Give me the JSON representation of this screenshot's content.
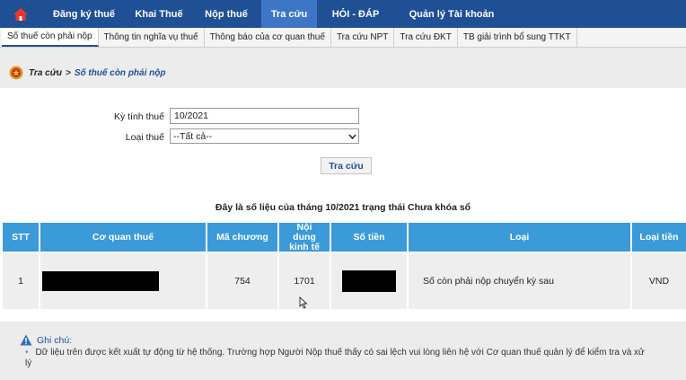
{
  "topnav": {
    "items": [
      {
        "label": "Đăng ký thuế"
      },
      {
        "label": "Khai Thuế"
      },
      {
        "label": "Nộp thuế"
      },
      {
        "label": "Tra cứu"
      },
      {
        "label": "HỎI - ĐÁP"
      },
      {
        "label": "Quản lý Tài khoản"
      }
    ],
    "active_index": 3,
    "color": "#1f4f94",
    "active_color": "#3d76c4"
  },
  "subnav": {
    "tabs": [
      {
        "label": "Số thuế còn phải nộp"
      },
      {
        "label": "Thông tin nghĩa vụ thuế"
      },
      {
        "label": "Thông báo của cơ quan thuế"
      },
      {
        "label": "Tra cứu NPT"
      },
      {
        "label": "Tra cứu ĐKT"
      },
      {
        "label": "TB giải trình bổ sung TTKT"
      }
    ],
    "active_index": 0
  },
  "breadcrumb": {
    "parent": "Tra cứu",
    "separator": ">",
    "current": "Số thuế còn phải nộp"
  },
  "form": {
    "period_label": "Kỳ tính thuế",
    "period_value": "10/2021",
    "type_label": "Loại thuế",
    "type_selected": "--Tất cả--",
    "search_button": "Tra cứu"
  },
  "caption": "Đây là số liệu của tháng 10/2021 trạng thái Chưa khóa sổ",
  "table": {
    "header_color": "#3b9ad8",
    "columns": [
      "STT",
      "Cơ quan thuế",
      "Mã chương",
      "Nội dung kinh tế",
      "Số tiền",
      "Loại",
      "Loại tiền"
    ],
    "rows": [
      {
        "stt": "1",
        "agency": "",
        "chapter": "754",
        "economic_content": "1701",
        "amount": "",
        "type": "Số còn phải nộp chuyển kỳ sau",
        "currency": "VND"
      }
    ]
  },
  "note": {
    "title": "Ghi chú:",
    "text": "Dữ liệu trên được kết xuất tự động từ hệ thống. Trường hợp Người Nộp thuế thấy có sai lệch vui lòng liên hệ với Cơ quan thuế quản lý để kiểm tra và xử lý"
  },
  "icons": {
    "home": "home-icon",
    "seal": "emblem-icon",
    "warning": "warning-icon",
    "dropdown": "chevron-down-icon",
    "cursor": "mouse-cursor-icon"
  }
}
